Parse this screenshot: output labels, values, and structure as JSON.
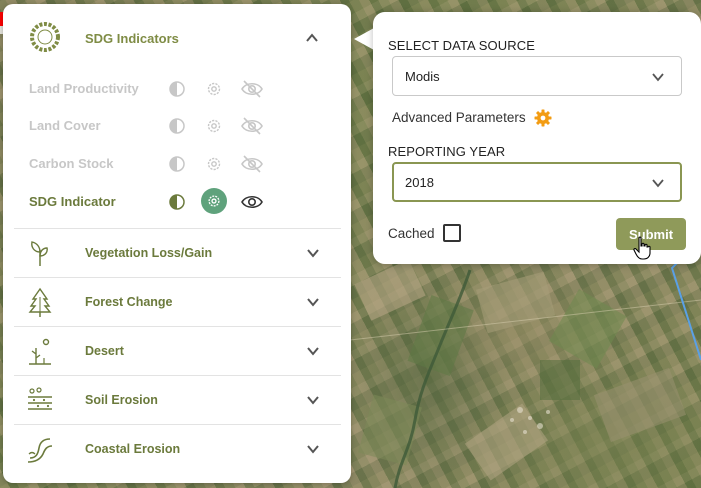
{
  "sidebar": {
    "sdg_title": "SDG Indicators",
    "indicators": [
      {
        "label": "Land Productivity",
        "active": false
      },
      {
        "label": "Land Cover",
        "active": false
      },
      {
        "label": "Carbon Stock",
        "active": false
      },
      {
        "label": "SDG Indicator",
        "active": true
      }
    ],
    "sections": [
      {
        "label": "Vegetation Loss/Gain",
        "icon": "sprout-icon"
      },
      {
        "label": "Forest Change",
        "icon": "tree-icon"
      },
      {
        "label": "Desert",
        "icon": "desert-plant-icon"
      },
      {
        "label": "Soil Erosion",
        "icon": "soil-layers-icon"
      },
      {
        "label": "Coastal Erosion",
        "icon": "wave-icon"
      }
    ]
  },
  "popup": {
    "data_source_label": "SELECT DATA SOURCE",
    "data_source_value": "Modis",
    "advanced_label": "Advanced Parameters",
    "year_label": "REPORTING YEAR",
    "year_value": "2018",
    "cached_label": "Cached",
    "cached_checked": false,
    "submit_label": "Submit"
  },
  "colors": {
    "accent_olive": "#7f8c45",
    "dark_olive": "#6b7a3c",
    "muted_gray": "#c7c7c7",
    "gear_active_bg": "#5fa27c",
    "submit_bg": "#8f9a5a",
    "advanced_gear": "#f39c12",
    "map_overlay": "#ff0000"
  }
}
